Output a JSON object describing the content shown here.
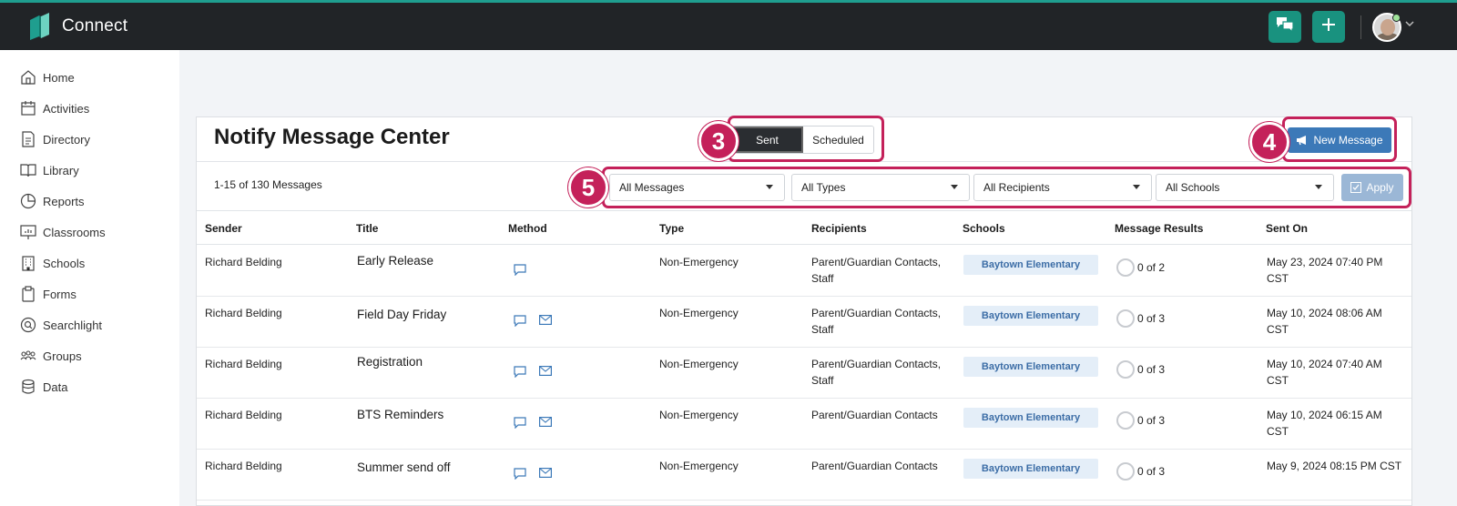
{
  "app": {
    "name": "Connect"
  },
  "header": {
    "chat_icon": "chat-bubbles-icon",
    "add_icon": "plus-icon"
  },
  "sidebar": {
    "items": [
      {
        "label": "Home",
        "icon": "home-icon"
      },
      {
        "label": "Activities",
        "icon": "calendar-icon"
      },
      {
        "label": "Directory",
        "icon": "document-icon"
      },
      {
        "label": "Library",
        "icon": "book-icon"
      },
      {
        "label": "Reports",
        "icon": "pie-chart-icon"
      },
      {
        "label": "Classrooms",
        "icon": "presentation-board-icon"
      },
      {
        "label": "Schools",
        "icon": "building-icon"
      },
      {
        "label": "Forms",
        "icon": "clipboard-icon"
      },
      {
        "label": "Searchlight",
        "icon": "search-circle-icon"
      },
      {
        "label": "Groups",
        "icon": "people-icon"
      },
      {
        "label": "Data",
        "icon": "database-icon"
      }
    ]
  },
  "page": {
    "title": "Notify Message Center",
    "tabs": {
      "sent": "Sent",
      "scheduled": "Scheduled"
    },
    "new_message": "New Message",
    "count_text": "1-15 of 130 Messages",
    "filters": {
      "messages": "All Messages",
      "types": "All Types",
      "recipients": "All Recipients",
      "schools": "All Schools",
      "apply": "Apply"
    }
  },
  "table": {
    "headers": [
      "Sender",
      "Title",
      "Method",
      "Type",
      "Recipients",
      "Schools",
      "Message Results",
      "Sent On"
    ],
    "rows": [
      {
        "sender": "Richard Belding",
        "title": "Early Release",
        "methods": [
          "sms"
        ],
        "type": "Non-Emergency",
        "recipients_1": "Parent/Guardian Contacts,",
        "recipients_2": "Staff",
        "school": "Baytown Elementary",
        "result": "0 of 2",
        "sent_1": "May 23, 2024 07:40 PM",
        "sent_2": "CST"
      },
      {
        "sender": "Richard Belding",
        "title": "Field Day Friday",
        "methods": [
          "sms",
          "email"
        ],
        "type": "Non-Emergency",
        "recipients_1": "Parent/Guardian Contacts,",
        "recipients_2": "Staff",
        "school": "Baytown Elementary",
        "result": "0 of 3",
        "sent_1": "May 10, 2024 08:06 AM",
        "sent_2": "CST"
      },
      {
        "sender": "Richard Belding",
        "title": "Registration",
        "methods": [
          "sms",
          "email"
        ],
        "type": "Non-Emergency",
        "recipients_1": "Parent/Guardian Contacts,",
        "recipients_2": "Staff",
        "school": "Baytown Elementary",
        "result": "0 of 3",
        "sent_1": "May 10, 2024 07:40 AM",
        "sent_2": "CST"
      },
      {
        "sender": "Richard Belding",
        "title": "BTS Reminders",
        "methods": [
          "sms",
          "email"
        ],
        "type": "Non-Emergency",
        "recipients_1": "Parent/Guardian Contacts",
        "recipients_2": "",
        "school": "Baytown Elementary",
        "result": "0 of 3",
        "sent_1": "May 10, 2024 06:15 AM",
        "sent_2": "CST"
      },
      {
        "sender": "Richard Belding",
        "title": "Summer send off",
        "methods": [
          "sms",
          "email"
        ],
        "type": "Non-Emergency",
        "recipients_1": "Parent/Guardian Contacts",
        "recipients_2": "",
        "school": "Baytown Elementary",
        "result": "0 of 3",
        "sent_1": "May 9, 2024 08:15 PM CST",
        "sent_2": ""
      }
    ]
  },
  "callouts": [
    "3",
    "4",
    "5"
  ],
  "colors": {
    "accent": "#19927f",
    "topbar": "#212427",
    "primary_button": "#3c79b8",
    "callout": "#c4215a"
  }
}
